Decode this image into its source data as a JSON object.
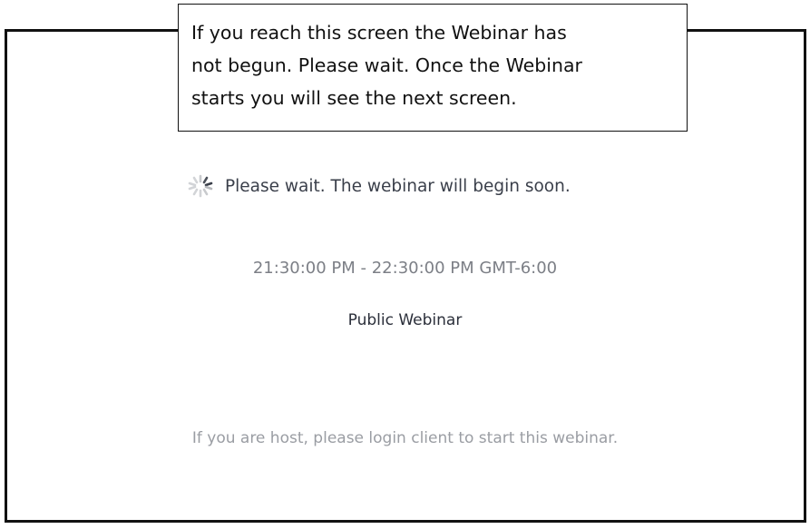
{
  "callout": {
    "text": "If you reach this screen the Webinar has\nnot begun. Please wait. Once the Webinar\nstarts you will see the next screen."
  },
  "webinar": {
    "wait_message": "Please wait. The webinar will begin soon.",
    "time_range": "21:30:00 PM - 22:30:00 PM GMT-6:00",
    "topic": "Public Webinar",
    "host_note": "If you are host, please login client to start this webinar."
  },
  "icons": {
    "loading": "loading-spinner-icon"
  },
  "colors": {
    "border": "#111111",
    "text_dark": "#2b2f3a",
    "text_muted": "#9a9da3"
  }
}
